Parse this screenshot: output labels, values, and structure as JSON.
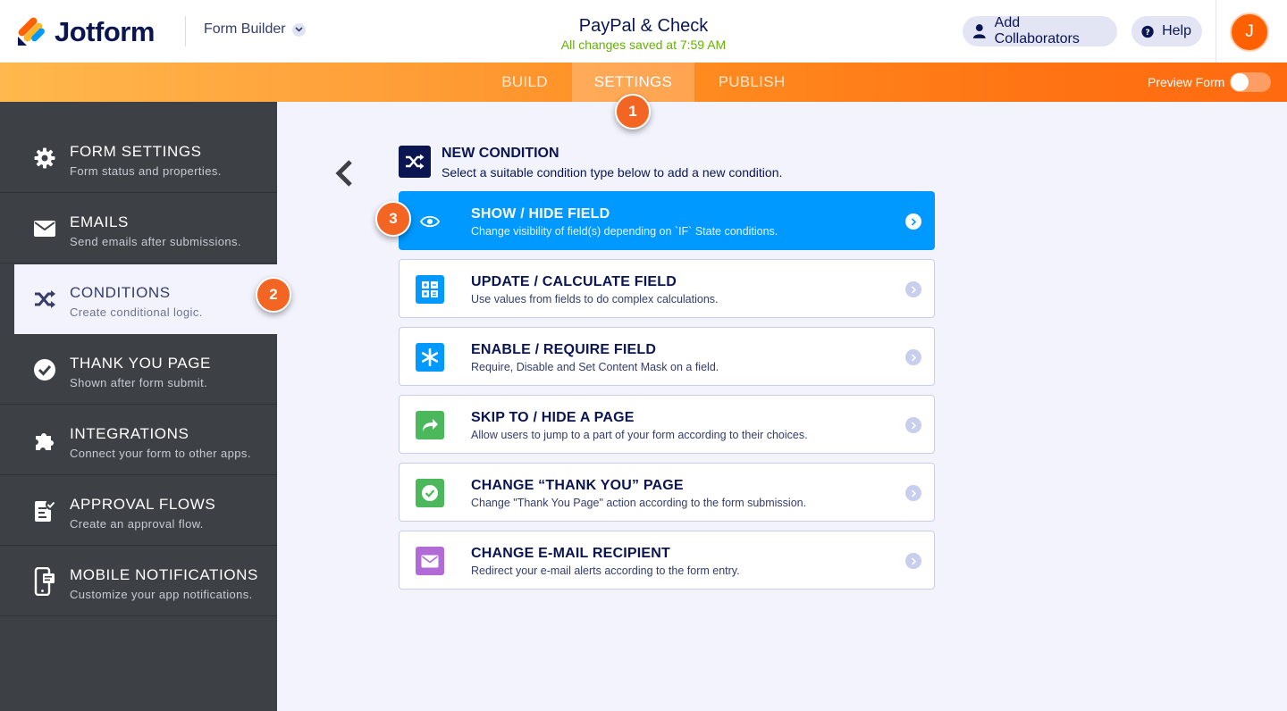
{
  "header": {
    "logo_text": "Jotform",
    "builder_menu": "Form Builder",
    "form_title": "PayPal & Check",
    "save_status": "All changes saved at 7:59 AM",
    "add_collaborators": "Add Collaborators",
    "help": "Help",
    "avatar_initial": "J"
  },
  "nav": {
    "tabs": [
      {
        "label": "BUILD",
        "active": false
      },
      {
        "label": "SETTINGS",
        "active": true
      },
      {
        "label": "PUBLISH",
        "active": false
      }
    ],
    "preview_label": "Preview Form",
    "preview_on": false
  },
  "sidebar": {
    "items": [
      {
        "title": "FORM SETTINGS",
        "subtitle": "Form status and properties.",
        "icon": "gear-icon"
      },
      {
        "title": "EMAILS",
        "subtitle": "Send emails after submissions.",
        "icon": "envelope-icon"
      },
      {
        "title": "CONDITIONS",
        "subtitle": "Create conditional logic.",
        "icon": "shuffle-icon",
        "active": true
      },
      {
        "title": "THANK YOU PAGE",
        "subtitle": "Shown after form submit.",
        "icon": "check-circle-icon"
      },
      {
        "title": "INTEGRATIONS",
        "subtitle": "Connect your form to other apps.",
        "icon": "puzzle-icon"
      },
      {
        "title": "APPROVAL FLOWS",
        "subtitle": "Create an approval flow.",
        "icon": "approval-icon"
      },
      {
        "title": "MOBILE NOTIFICATIONS",
        "subtitle": "Customize your app notifications.",
        "icon": "mobile-icon"
      }
    ]
  },
  "main": {
    "heading": "NEW CONDITION",
    "subheading": "Select a suitable condition type below to add a new condition.",
    "conditions": [
      {
        "title": "SHOW / HIDE FIELD",
        "subtitle": "Change visibility of field(s) depending on `IF` State conditions.",
        "icon": "eye-icon",
        "selected": true
      },
      {
        "title": "UPDATE / CALCULATE FIELD",
        "subtitle": "Use values from fields to do complex calculations.",
        "icon": "calculator-icon",
        "color": "#0099ff"
      },
      {
        "title": "ENABLE / REQUIRE FIELD",
        "subtitle": "Require, Disable and Set Content Mask on a field.",
        "icon": "asterisk-icon",
        "color": "#0099ff"
      },
      {
        "title": "SKIP TO / HIDE A PAGE",
        "subtitle": "Allow users to jump to a part of your form according to their choices.",
        "icon": "skip-arrow-icon",
        "color": "#64b200"
      },
      {
        "title": "CHANGE “THANK YOU” PAGE",
        "subtitle": "Change \"Thank You Page\" action according to the form submission.",
        "icon": "check-circle-icon",
        "color": "#4cb85c"
      },
      {
        "title": "CHANGE E-MAIL RECIPIENT",
        "subtitle": "Redirect your e-mail alerts according to the form entry.",
        "icon": "envelope-icon",
        "color": "#b26bd6"
      }
    ]
  },
  "badges": [
    "1",
    "2",
    "3"
  ],
  "colors": {
    "accent_orange": "#ff6100",
    "navy": "#0a1551",
    "selected_blue": "#0099ff",
    "sidebar_dark": "#3d4145",
    "badge_orange": "#f26522",
    "saved_green": "#64b200"
  }
}
